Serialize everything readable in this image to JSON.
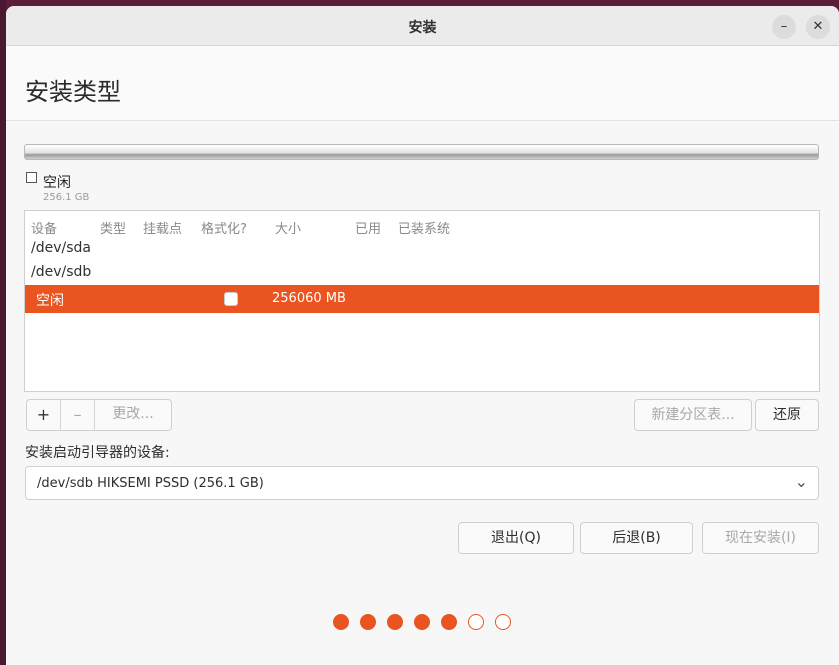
{
  "window": {
    "title": "安装",
    "minimize_label": "–",
    "close_label": "✕"
  },
  "page": {
    "heading": "安装类型"
  },
  "partition_legend": {
    "name": "空闲",
    "size": "256.1 GB"
  },
  "table": {
    "columns": [
      "设备",
      "类型",
      "挂载点",
      "格式化?",
      "大小",
      "已用",
      "已装系统"
    ],
    "rows": [
      {
        "device": "/dev/sda"
      },
      {
        "device": "/dev/sdb"
      },
      {
        "device": "空闲",
        "size": "256060 MB",
        "selected": true
      }
    ]
  },
  "partition_buttons": {
    "add": "+",
    "remove": "–",
    "change": "更改..."
  },
  "table_buttons": {
    "new_table": "新建分区表...",
    "revert": "还原"
  },
  "bootloader": {
    "label": "安装启动引导器的设备:",
    "selected": "/dev/sdb   HIKSEMI PSSD (256.1 GB)"
  },
  "nav": {
    "quit": "退出(Q)",
    "back": "后退(B)",
    "install": "现在安装(I)"
  },
  "progress": {
    "total": 7,
    "completed": 5
  },
  "colors": {
    "accent": "#e95420"
  }
}
